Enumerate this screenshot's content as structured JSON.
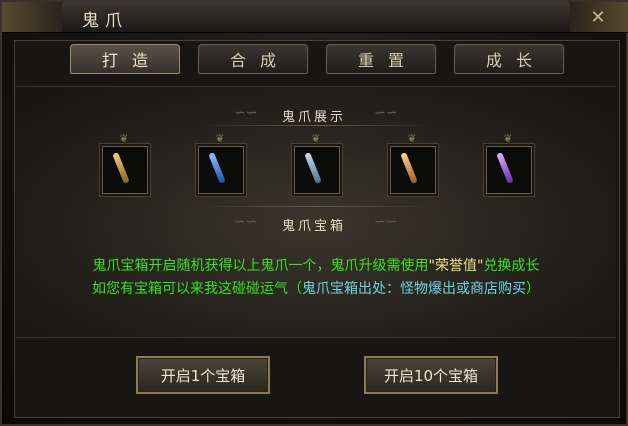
{
  "window": {
    "title": "鬼爪",
    "close": "✕"
  },
  "tabs": [
    {
      "label": "打造",
      "active": true
    },
    {
      "label": "合成",
      "active": false
    },
    {
      "label": "重置",
      "active": false
    },
    {
      "label": "成长",
      "active": false
    }
  ],
  "showcase": {
    "title": "鬼爪展示",
    "items": [
      {
        "name": "claw-1",
        "color": "#d8b25a"
      },
      {
        "name": "claw-2",
        "color": "#3f7fd6"
      },
      {
        "name": "claw-3",
        "color": "#7ab0d0"
      },
      {
        "name": "claw-4",
        "color": "#e0a060"
      },
      {
        "name": "claw-5",
        "color": "#b070e0"
      }
    ]
  },
  "box": {
    "title": "鬼爪宝箱",
    "line1_a": "鬼爪宝箱开启随机获得以上鬼爪一个，鬼爪升级需使用",
    "line1_hl": "\"荣誉值\"",
    "line1_b": "兑换成长",
    "line2_a": "如您有宝箱可以来我这碰碰运气（",
    "line2_b": "鬼爪宝箱出处：怪物爆出或商店购买",
    "line2_c": "）"
  },
  "buttons": {
    "open_one": "开启1个宝箱",
    "open_ten": "开启10个宝箱"
  }
}
